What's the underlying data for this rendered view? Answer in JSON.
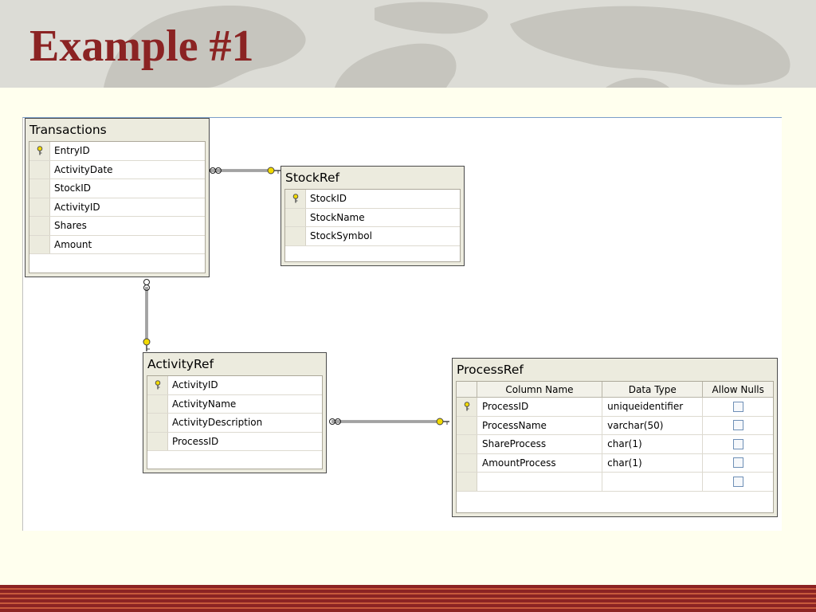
{
  "slide": {
    "title": "Example #1"
  },
  "tables": {
    "transactions": {
      "title": "Transactions",
      "columns": [
        {
          "name": "EntryID",
          "key": true
        },
        {
          "name": "ActivityDate",
          "key": false
        },
        {
          "name": "StockID",
          "key": false
        },
        {
          "name": "ActivityID",
          "key": false
        },
        {
          "name": "Shares",
          "key": false
        },
        {
          "name": "Amount",
          "key": false
        }
      ]
    },
    "stockref": {
      "title": "StockRef",
      "columns": [
        {
          "name": "StockID",
          "key": true
        },
        {
          "name": "StockName",
          "key": false
        },
        {
          "name": "StockSymbol",
          "key": false
        }
      ]
    },
    "activityref": {
      "title": "ActivityRef",
      "columns": [
        {
          "name": "ActivityID",
          "key": true
        },
        {
          "name": "ActivityName",
          "key": false
        },
        {
          "name": "ActivityDescription",
          "key": false
        },
        {
          "name": "ProcessID",
          "key": false
        }
      ]
    },
    "processref": {
      "title": "ProcessRef",
      "headers": {
        "column_name": "Column Name",
        "data_type": "Data Type",
        "allow_nulls": "Allow Nulls"
      },
      "columns": [
        {
          "name": "ProcessID",
          "type": "uniqueidentifier",
          "key": true,
          "allow_nulls": false
        },
        {
          "name": "ProcessName",
          "type": "varchar(50)",
          "key": false,
          "allow_nulls": false
        },
        {
          "name": "ShareProcess",
          "type": "char(1)",
          "key": false,
          "allow_nulls": false
        },
        {
          "name": "AmountProcess",
          "type": "char(1)",
          "key": false,
          "allow_nulls": false
        },
        {
          "name": "",
          "type": "",
          "key": false,
          "allow_nulls": false
        }
      ]
    }
  },
  "colors": {
    "title": "#8B2323",
    "key_icon": "#D4B800",
    "table_bg": "#ECEBDE",
    "footer_stripe": "#8B2323"
  },
  "icons": {
    "primary_key": "key-icon",
    "infinity": "infinity-icon"
  }
}
